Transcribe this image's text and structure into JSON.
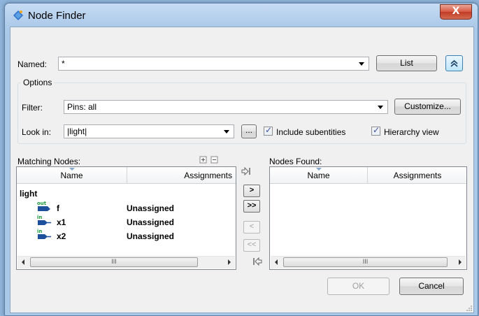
{
  "window": {
    "title": "Node Finder",
    "close_label": "X"
  },
  "named": {
    "label": "Named:",
    "value": "*",
    "list_button": "List"
  },
  "options": {
    "group_title": "Options",
    "filter": {
      "label": "Filter:",
      "value": "Pins: all",
      "customize_button": "Customize..."
    },
    "look_in": {
      "label": "Look in:",
      "value": "|light|",
      "browse_button": "..."
    },
    "include_subentities": {
      "label": "Include subentities",
      "checked": true
    },
    "hierarchy_view": {
      "label": "Hierarchy view",
      "checked": true
    }
  },
  "matching_nodes": {
    "label": "Matching Nodes:",
    "columns": [
      "Name",
      "Assignments"
    ],
    "root": "light",
    "rows": [
      {
        "pin_type": "out",
        "name": "f",
        "assignment": "Unassigned",
        "icon": "output-pin-icon"
      },
      {
        "pin_type": "in",
        "name": "x1",
        "assignment": "Unassigned",
        "icon": "input-pin-icon"
      },
      {
        "pin_type": "in",
        "name": "x2",
        "assignment": "Unassigned",
        "icon": "input-pin-icon"
      }
    ]
  },
  "nodes_found": {
    "label": "Nodes Found:",
    "columns": [
      "Name",
      "Assignments"
    ],
    "rows": []
  },
  "transfer_buttons": {
    "add": ">",
    "add_all": ">>",
    "remove": "<",
    "remove_all": "<<"
  },
  "scroll_thumb": "III",
  "footer": {
    "ok": "OK",
    "cancel": "Cancel"
  },
  "colors": {
    "pin_icon": "#1c4f9c",
    "pin_text": "#1a9a3a",
    "titlebar": "#aecbea",
    "close": "#c13b26"
  }
}
